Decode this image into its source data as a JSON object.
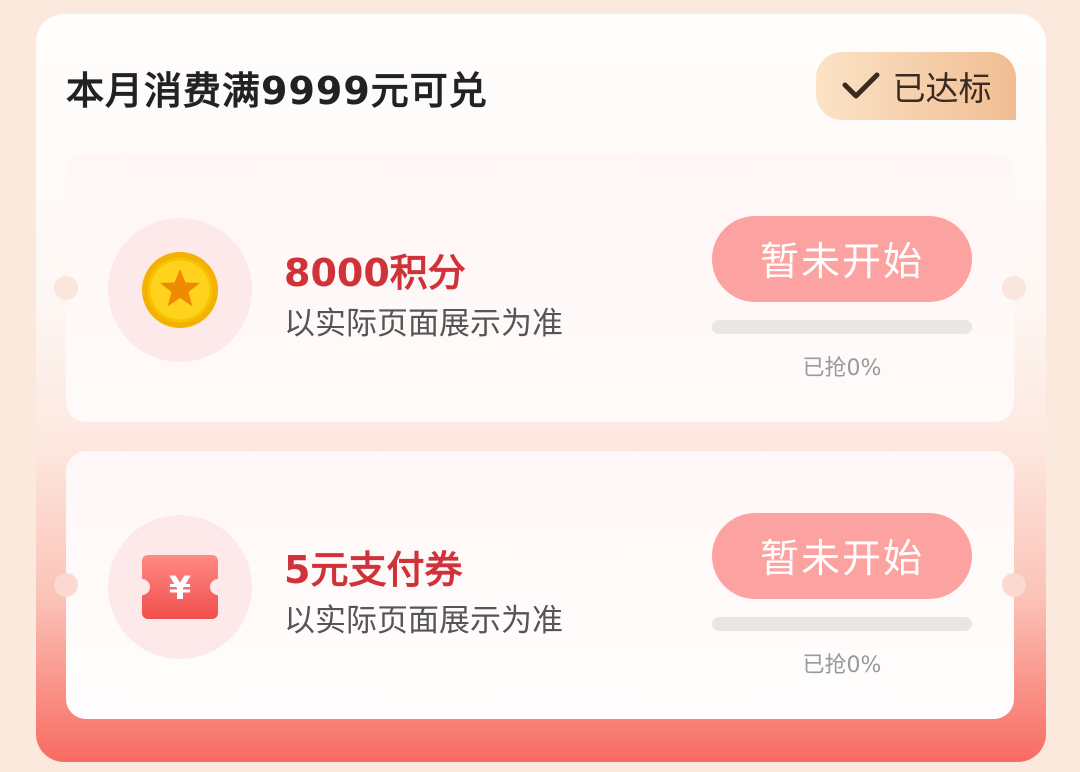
{
  "header": {
    "title": "本月消费满9999元可兑",
    "badge_label": "已达标",
    "badge_icon": "check-icon"
  },
  "rewards": [
    {
      "name": "8000积分",
      "desc": "以实际页面展示为准",
      "icon": "coin-star-icon",
      "button_label": "暂未开始",
      "progress_text": "已抢0%",
      "progress_value": 0
    },
    {
      "name": "5元支付券",
      "desc": "以实际页面展示为准",
      "icon": "yuan-ticket-icon",
      "ticket_glyph": "¥",
      "button_label": "暂未开始",
      "progress_text": "已抢0%",
      "progress_value": 0
    }
  ],
  "colors": {
    "accent": "#d0323a",
    "button": "#fca2a0",
    "badge": "#f1bd93"
  }
}
